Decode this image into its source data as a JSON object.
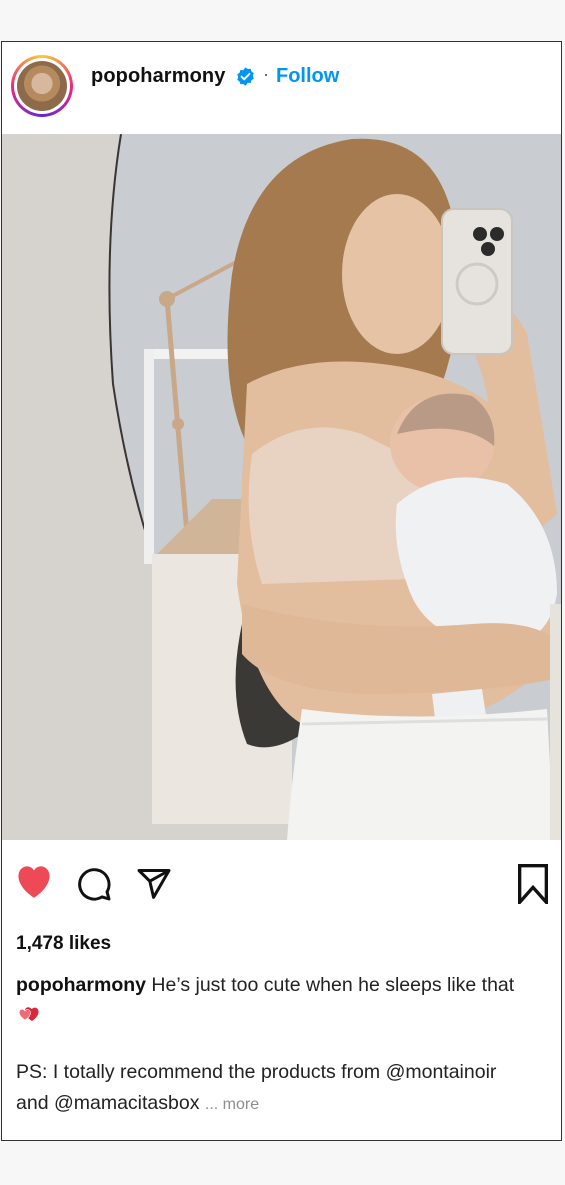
{
  "post": {
    "username": "popoharmony",
    "separator": "·",
    "follow_label": "Follow",
    "likes": "1,478 likes",
    "caption_user": "popoharmony",
    "caption_text": "He’s just too cute when he sleeps like that",
    "ps_line1": "PS: I totally recommend the products from @montainoir",
    "ps_line2": "and @mamacitasbox",
    "more_label": "... more"
  },
  "icons": {
    "verified": "verified-badge-icon",
    "like": "heart-icon",
    "comment": "comment-icon",
    "share": "share-icon",
    "save": "bookmark-icon",
    "caption_emoji": "two-hearts-icon"
  },
  "colors": {
    "accent": "#0095f6",
    "like_red": "#ed4956",
    "muted": "#8e8e8e"
  }
}
